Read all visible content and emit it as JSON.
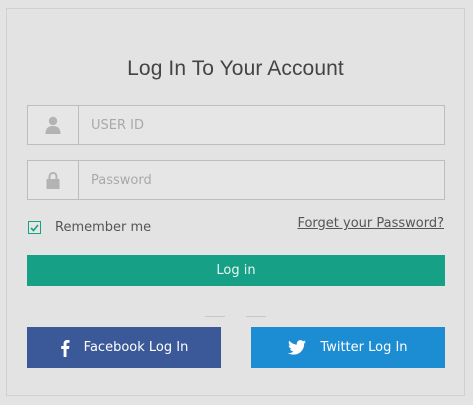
{
  "form": {
    "title": "Log In To Your Account",
    "user_id_placeholder": "USER ID",
    "password_placeholder": "Password",
    "remember_label": "Remember me",
    "remember_checked": true,
    "forgot_label": "Forget your Password?",
    "login_label": "Log in"
  },
  "social": {
    "facebook_label": "Facebook Log In",
    "twitter_label": "Twitter Log In"
  },
  "icons": {
    "user": "user-icon",
    "lock": "lock-icon",
    "check": "check-icon",
    "facebook": "facebook-icon",
    "twitter": "twitter-icon"
  },
  "colors": {
    "background": "#e3e3e3",
    "accent": "#16a085",
    "facebook": "#3b5998",
    "twitter": "#1d8dd3"
  }
}
